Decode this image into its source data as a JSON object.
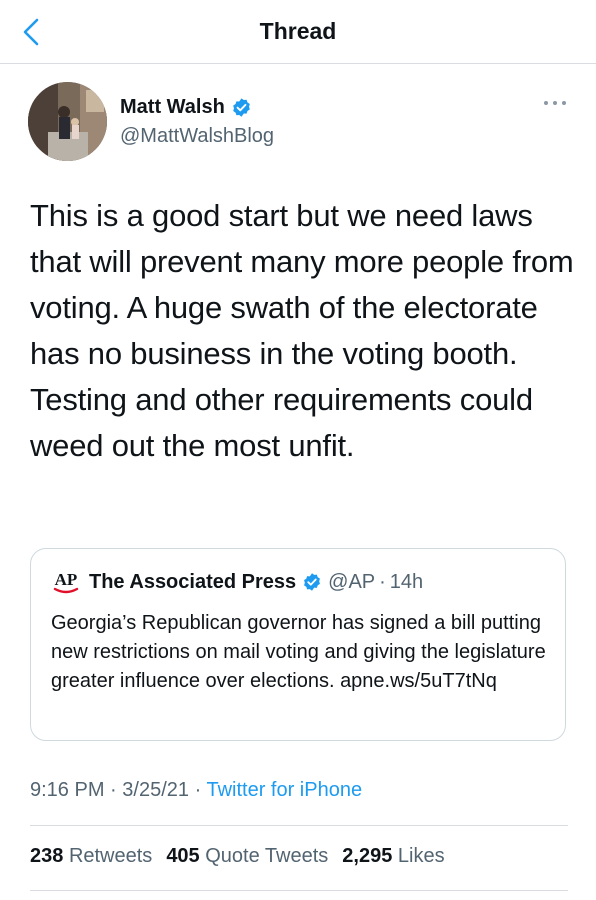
{
  "nav": {
    "title": "Thread"
  },
  "author": {
    "display_name": "Matt Walsh",
    "handle": "@MattWalshBlog",
    "verified": true
  },
  "tweet": {
    "text": "This is a good start but we need laws that will prevent many more people from voting. A huge swath of the electorate has no business in the voting booth. Testing and other requirements could weed out the most unfit."
  },
  "quoted": {
    "logo_text": "AP",
    "name": "The Associated Press",
    "verified": true,
    "handle": "@AP",
    "separator": "·",
    "time": "14h",
    "text": "Georgia’s Republican governor has signed a bill putting new restrictions on mail voting and giving the legislature greater influence over elections.",
    "link": "apne.ws/5uT7tNq"
  },
  "meta": {
    "time": "9:16 PM",
    "separator": "·",
    "date": "3/25/21",
    "separator2": "·",
    "source": "Twitter for iPhone"
  },
  "stats": {
    "retweets_count": "238",
    "retweets_label": "Retweets",
    "quotes_count": "405",
    "quotes_label": "Quote Tweets",
    "likes_count": "2,295",
    "likes_label": "Likes"
  },
  "colors": {
    "accent": "#1d9bf0",
    "text_primary": "#0f1419",
    "text_secondary": "#536471",
    "divider": "#d9dde1",
    "ap_red": "#e0102b"
  },
  "icons": {
    "back": "chevron-left-icon",
    "verified": "verified-badge-icon",
    "more": "more-dots-icon"
  }
}
